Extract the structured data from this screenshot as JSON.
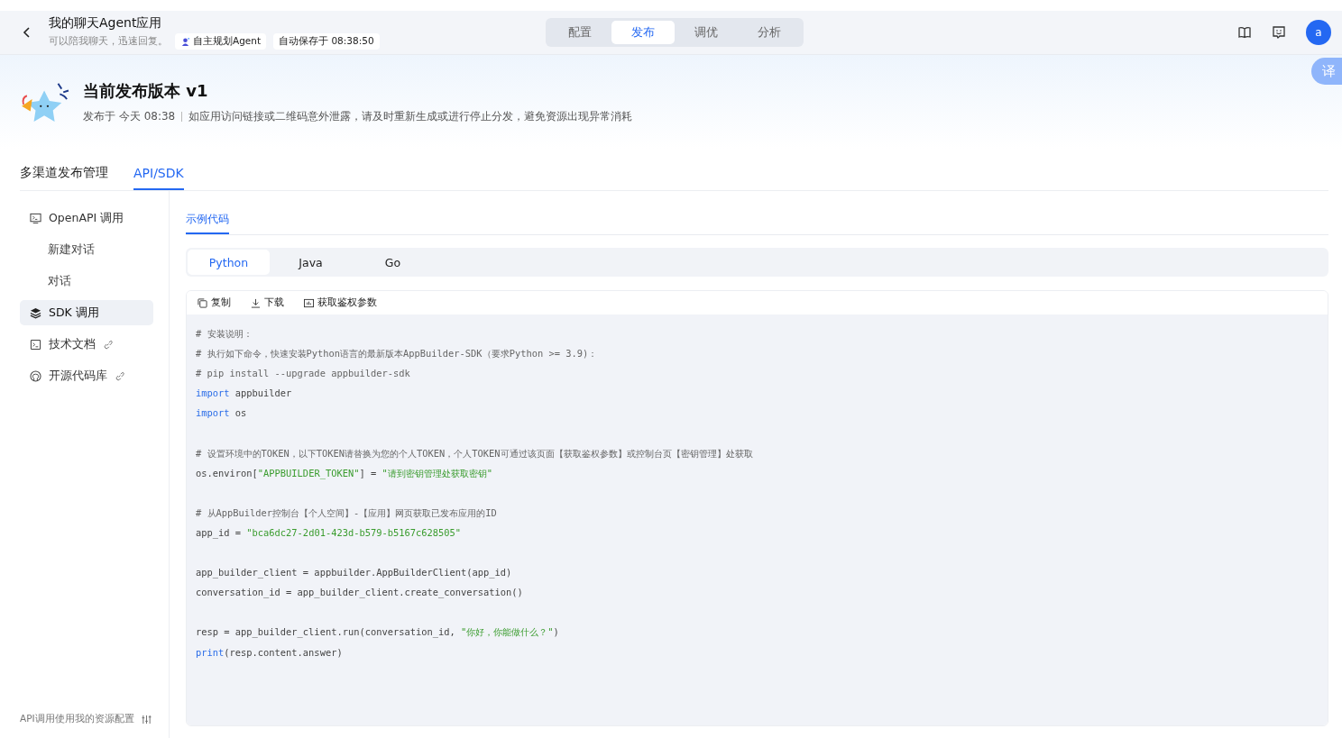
{
  "header": {
    "title": "我的聊天Agent应用",
    "subtitle": "可以陪我聊天，迅速回复。",
    "agent_tag": "自主规划Agent",
    "autosave": "自动保存于 08:38:50",
    "avatar": "a",
    "translate": "译"
  },
  "top_tabs": [
    {
      "label": "配置",
      "selected": false
    },
    {
      "label": "发布",
      "selected": true
    },
    {
      "label": "调优",
      "selected": false
    },
    {
      "label": "分析",
      "selected": false
    }
  ],
  "release": {
    "title": "当前发布版本 v1",
    "published": "发布于 今天 08:38",
    "notice": "如应用访问链接或二维码意外泄露，请及时重新生成或进行停止分发，避免资源出现异常消耗"
  },
  "main_tabs": [
    {
      "label": "多渠道发布管理",
      "selected": false
    },
    {
      "label": "API/SDK",
      "selected": true
    }
  ],
  "sidebar": {
    "items": [
      {
        "kind": "section",
        "label": "OpenAPI 调用",
        "selected": false
      },
      {
        "kind": "sub",
        "label": "新建对话",
        "selected": false
      },
      {
        "kind": "sub",
        "label": "对话",
        "selected": false
      },
      {
        "kind": "section",
        "label": "SDK 调用",
        "selected": true
      },
      {
        "kind": "link",
        "label": "技术文档",
        "selected": false
      },
      {
        "kind": "link",
        "label": "开源代码库",
        "selected": false
      }
    ],
    "footer": "API调用使用我的资源配置"
  },
  "sub_tab": {
    "label": "示例代码",
    "selected": true
  },
  "languages": [
    {
      "label": "Python",
      "selected": true
    },
    {
      "label": "Java",
      "selected": false
    },
    {
      "label": "Go",
      "selected": false
    }
  ],
  "toolbar": [
    "复制",
    "下载",
    "获取鉴权参数"
  ],
  "code": [
    {
      "kind": "code",
      "tokens": [
        {
          "kind": "comment",
          "text": "# 安装说明："
        }
      ]
    },
    {
      "kind": "code",
      "tokens": [
        {
          "kind": "comment",
          "text": "# 执行如下命令，快速安装Python语言的最新版本AppBuilder-SDK（要求Python >= 3.9)："
        }
      ]
    },
    {
      "kind": "code",
      "tokens": [
        {
          "kind": "comment",
          "text": "# pip install --upgrade appbuilder-sdk"
        }
      ]
    },
    {
      "kind": "code",
      "tokens": [
        {
          "kind": "keyword",
          "text": "import"
        },
        {
          "kind": "plain",
          "text": " appbuilder"
        }
      ]
    },
    {
      "kind": "code",
      "tokens": [
        {
          "kind": "keyword",
          "text": "import"
        },
        {
          "kind": "plain",
          "text": " os"
        }
      ]
    },
    {
      "kind": "blank"
    },
    {
      "kind": "code",
      "tokens": [
        {
          "kind": "comment",
          "text": "# 设置环境中的TOKEN，以下TOKEN请替换为您的个人TOKEN，个人TOKEN可通过该页面【获取鉴权参数】或控制台页【密钥管理】处获取"
        }
      ]
    },
    {
      "kind": "code",
      "tokens": [
        {
          "kind": "plain",
          "text": "os.environ["
        },
        {
          "kind": "string",
          "text": "\"APPBUILDER_TOKEN\""
        },
        {
          "kind": "plain",
          "text": "] = "
        },
        {
          "kind": "string",
          "text": "\"请到密钥管理处获取密钥\""
        }
      ]
    },
    {
      "kind": "blank"
    },
    {
      "kind": "code",
      "tokens": [
        {
          "kind": "comment",
          "text": "# 从AppBuilder控制台【个人空间】-【应用】网页获取已发布应用的ID"
        }
      ]
    },
    {
      "kind": "code",
      "tokens": [
        {
          "kind": "plain",
          "text": "app_id = "
        },
        {
          "kind": "string",
          "text": "\"bca6dc27-2d01-423d-b579-b5167c628505\""
        }
      ]
    },
    {
      "kind": "blank"
    },
    {
      "kind": "code",
      "tokens": [
        {
          "kind": "plain",
          "text": "app_builder_client = appbuilder.AppBuilderClient(app_id)"
        }
      ]
    },
    {
      "kind": "code",
      "tokens": [
        {
          "kind": "plain",
          "text": "conversation_id = app_builder_client.create_conversation()"
        }
      ]
    },
    {
      "kind": "blank"
    },
    {
      "kind": "code",
      "tokens": [
        {
          "kind": "plain",
          "text": "resp = app_builder_client.run(conversation_id, "
        },
        {
          "kind": "string",
          "text": "\"你好，你能做什么？\""
        },
        {
          "kind": "plain",
          "text": ")"
        }
      ]
    },
    {
      "kind": "code",
      "tokens": [
        {
          "kind": "keyword",
          "text": "print"
        },
        {
          "kind": "plain",
          "text": "(resp.content.answer)"
        }
      ]
    }
  ]
}
